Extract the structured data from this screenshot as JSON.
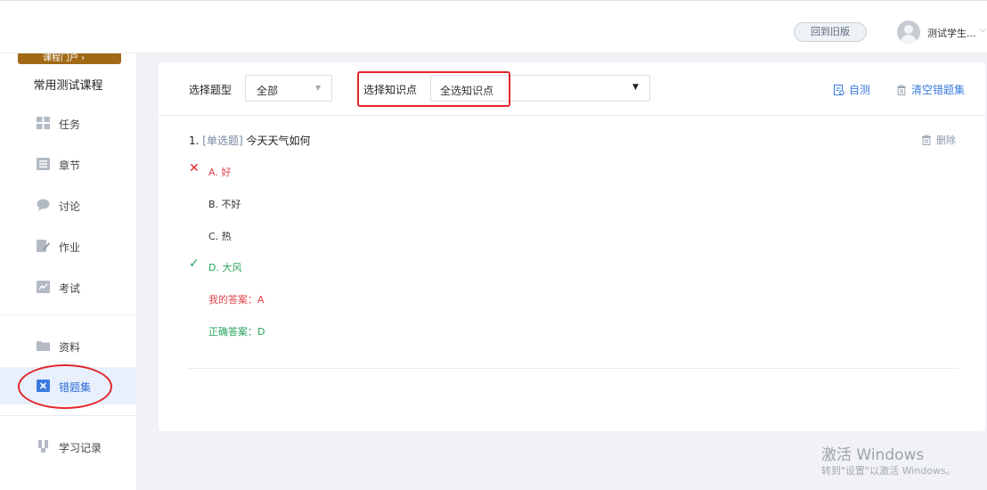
{
  "header": {
    "old_version_label": "回到旧版",
    "username": "测试学生...",
    "chevron": "⌵"
  },
  "sidebar": {
    "portal_label": "课程门户 ›",
    "course_title": "常用测试课程",
    "items": [
      {
        "label": "任务",
        "icon": "grid-icon"
      },
      {
        "label": "章节",
        "icon": "list-icon"
      },
      {
        "label": "讨论",
        "icon": "chat-bubble-icon"
      },
      {
        "label": "作业",
        "icon": "edit-doc-icon"
      },
      {
        "label": "考试",
        "icon": "exam-icon"
      },
      {
        "label": "资料",
        "icon": "folder-icon"
      },
      {
        "label": "错题集",
        "icon": "wrong-set-icon"
      },
      {
        "label": "学习记录",
        "icon": "record-icon"
      }
    ],
    "active_item": "错题集"
  },
  "filters": {
    "type_label": "选择题型",
    "type_value": "全部",
    "knowledge_label": "选择知识点",
    "knowledge_value": "全选知识点"
  },
  "actions": {
    "self_test": "自测",
    "clear_set": "清空错题集"
  },
  "question": {
    "number": "1.",
    "type_tag": "[单选题]",
    "text": "今天天气如何",
    "delete_label": "删除",
    "options": [
      {
        "text": "A. 好",
        "state": "wrong"
      },
      {
        "text": "B. 不好",
        "state": "normal"
      },
      {
        "text": "C. 热",
        "state": "normal"
      },
      {
        "text": "D. 大风",
        "state": "correct"
      }
    ],
    "my_answer": "我的答案：A",
    "correct_answer": "正确答案：D"
  },
  "watermark": {
    "line1": "激活 Windows",
    "line2": "转到\"设置\"以激活 Windows。"
  },
  "colors": {
    "accent": "#3a7be0",
    "wrong": "#e0454a",
    "correct": "#26a45c",
    "annotation": "#e2272a"
  }
}
